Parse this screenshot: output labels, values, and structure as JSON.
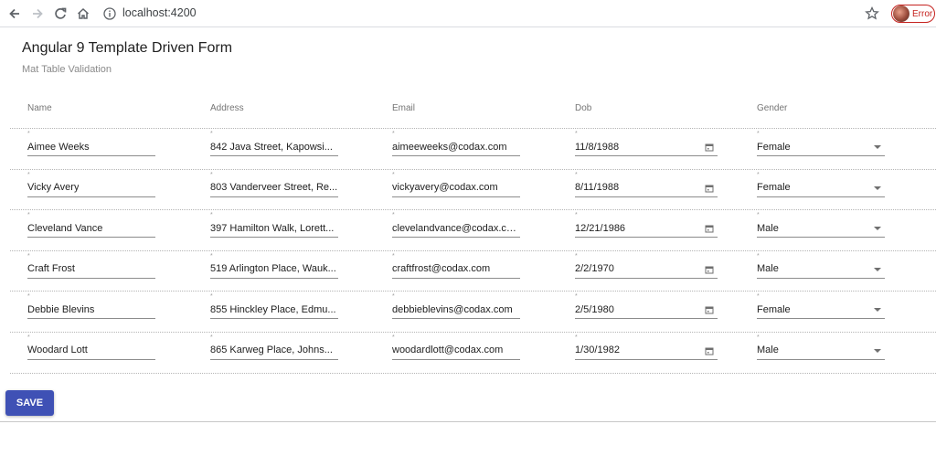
{
  "browser": {
    "url": "localhost:4200",
    "profile_label": "Error"
  },
  "page": {
    "title": "Angular 9 Template Driven Form",
    "subtitle": "Mat Table Validation"
  },
  "table": {
    "headers": {
      "name": "Name",
      "address": "Address",
      "email": "Email",
      "dob": "Dob",
      "gender": "Gender"
    },
    "field_marker": "*",
    "rows": [
      {
        "name": "Aimee Weeks",
        "address": "842 Java Street, Kapowsi...",
        "email": "aimeeweeks@codax.com",
        "dob": "11/8/1988",
        "gender": "Female"
      },
      {
        "name": "Vicky Avery",
        "address": "803 Vanderveer Street, Re...",
        "email": "vickyavery@codax.com",
        "dob": "8/11/1988",
        "gender": "Female"
      },
      {
        "name": "Cleveland Vance",
        "address": "397 Hamilton Walk, Lorett...",
        "email": "clevelandvance@codax.com",
        "dob": "12/21/1986",
        "gender": "Male"
      },
      {
        "name": "Craft Frost",
        "address": "519 Arlington Place, Wauk...",
        "email": "craftfrost@codax.com",
        "dob": "2/2/1970",
        "gender": "Male"
      },
      {
        "name": "Debbie Blevins",
        "address": "855 Hinckley Place, Edmu...",
        "email": "debbieblevins@codax.com",
        "dob": "2/5/1980",
        "gender": "Female"
      },
      {
        "name": "Woodard Lott",
        "address": "865 Karweg Place, Johns...",
        "email": "woodardlott@codax.com",
        "dob": "1/30/1982",
        "gender": "Male"
      }
    ]
  },
  "actions": {
    "save_label": "SAVE"
  },
  "icons": {
    "back": "back-arrow-icon",
    "forward": "forward-arrow-icon",
    "reload": "reload-icon",
    "home": "home-icon",
    "info": "info-icon",
    "star": "star-icon",
    "calendar": "calendar-icon",
    "dropdown": "chevron-down-icon"
  },
  "colors": {
    "primary": "#3f51b5",
    "error": "#c5221f"
  }
}
